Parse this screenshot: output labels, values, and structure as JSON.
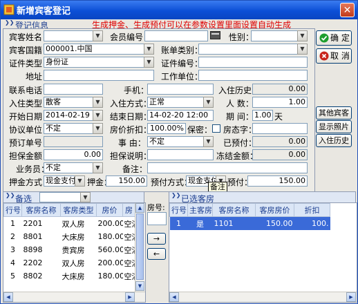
{
  "window": {
    "title": "新增宾客登记",
    "close_glyph": "✕"
  },
  "tab": {
    "label": "登记信息",
    "collapse_glyph": "❯❯"
  },
  "notice": "生成押金、生成预付可以在参数设置里面设置自动生成",
  "form": {
    "guest_name_label": "宾客姓名：",
    "guest_name_value": "",
    "member_no_label": "会员编号：",
    "member_no_value": "",
    "gender_label": "性别：",
    "gender_value": "",
    "nationality_label": "宾客国籍：",
    "nationality_value": "000001.中国",
    "bill_type_label": "账单类别：",
    "bill_type_value": "",
    "id_type_label": "证件类型：",
    "id_type_value": "身份证",
    "id_no_label": "证件编号：",
    "id_no_value": "",
    "address_label": "地址：",
    "address_value": "",
    "employer_label": "工作单位：",
    "employer_value": "",
    "phone_label": "联系电话：",
    "phone_value": "",
    "mobile_label": "手机：",
    "mobile_value": "",
    "history_label": "入住历史：",
    "history_value": "0.00",
    "checkin_type_label": "入住类型：",
    "checkin_type_value": "散客",
    "checkin_mode_label": "入住方式：",
    "checkin_mode_value": "正常",
    "persons_label": "人  数：",
    "persons_value": "1.00",
    "start_date_label": "开始日期：",
    "start_date_value": "2014-02-19",
    "end_date_label": "结束日期：",
    "end_date_value": "14-02-20 12:00",
    "period_label": "期  间：",
    "period_value": "1.00",
    "period_unit": "天",
    "agreement_unit_label": "协议单位：",
    "agreement_unit_value": "不定",
    "discount_label": "房价折扣：",
    "discount_value": "100.00%",
    "confidential_label": "保密：",
    "nickname_label": "房态字：",
    "nickname_value": "",
    "booking_no_label": "预订单号：",
    "booking_no_value": "",
    "reason_label": "事  由：",
    "reason_value": "不定",
    "prepaid_label": "已预付：",
    "prepaid_value": "0.00",
    "guarantee_amount_label": "担保金额：",
    "guarantee_amount_value": "0.00",
    "guarantee_note_label": "担保说明：",
    "guarantee_note_value": "",
    "credit_label": "冻结金额：",
    "credit_value": "0.00",
    "salesman_label": "业务员：",
    "salesman_value": "不定",
    "remark_label": "备注：",
    "remark_value": "",
    "deposit_method_label": "押金方式：",
    "deposit_method_value": "现金支付",
    "deposit_label": "押金：",
    "deposit_value": "150.00",
    "prepay_method_label": "预付方式：",
    "prepay_method_value": "现金支付",
    "prepay_label": "预付：",
    "prepay_value": "150.00",
    "tooltip": "备注"
  },
  "buttons": {
    "confirm": "确 定",
    "cancel": "取 消",
    "other_guests": "其他宾客",
    "show_photo": "显示照片",
    "checkin_history": "入住历史"
  },
  "backup_panel": {
    "title": "备选",
    "filter_value": "",
    "columns": [
      "行号",
      "客房名称",
      "客房类型",
      "房价",
      "房"
    ],
    "rows": [
      [
        "1",
        "2201",
        "双人房",
        "200.00",
        "空滔"
      ],
      [
        "2",
        "8801",
        "大床房",
        "180.00",
        "空滔"
      ],
      [
        "3",
        "8898",
        "贵宾房",
        "560.00",
        "空滔"
      ],
      [
        "4",
        "2202",
        "双人房",
        "200.00",
        "空滔"
      ],
      [
        "5",
        "8802",
        "大床房",
        "180.00",
        "空滔"
      ]
    ]
  },
  "room_no_label": "房号:",
  "room_no_value": "",
  "move_right": "→",
  "move_left": "←",
  "selected_panel": {
    "title": "已选客房",
    "columns": [
      "行号",
      "主客房",
      "客房名称",
      "客房房价",
      "折扣"
    ],
    "rows": [
      [
        "1",
        "是",
        "1101",
        "150.00",
        "100."
      ]
    ]
  },
  "colors": {
    "title_bar": "#0c4fd6",
    "notice": "#e00000",
    "selected_row": "#3a6ad8",
    "header_text": "#1b3d8f",
    "confirm_icon": "#1e9e2e",
    "cancel_icon": "#c8261c"
  }
}
